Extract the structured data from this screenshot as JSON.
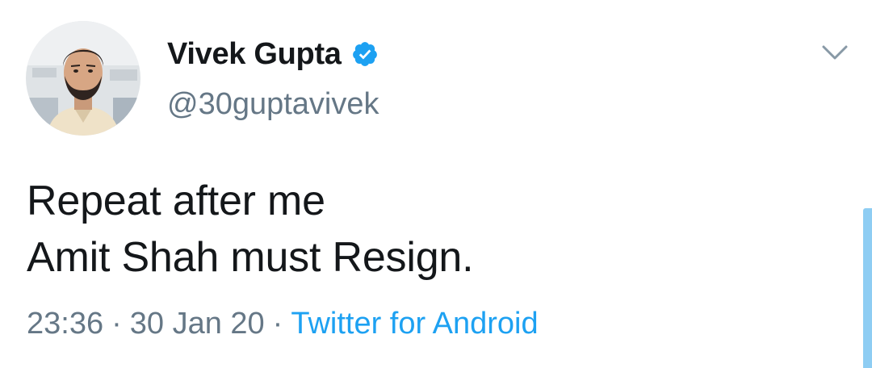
{
  "user": {
    "display_name": "Vivek Gupta",
    "handle": "@30guptavivek",
    "verified": true
  },
  "tweet": {
    "lines": [
      "Repeat after me",
      "Amit Shah must Resign."
    ],
    "time": "23:36",
    "date": "30 Jan 20",
    "source": "Twitter for Android",
    "separator": "·"
  },
  "icons": {
    "verified": "verified-badge-icon",
    "caret": "chevron-down-icon"
  },
  "colors": {
    "text": "#14171a",
    "secondary": "#657786",
    "link": "#1da1f2",
    "scrollbar": "#8ecdf3"
  }
}
